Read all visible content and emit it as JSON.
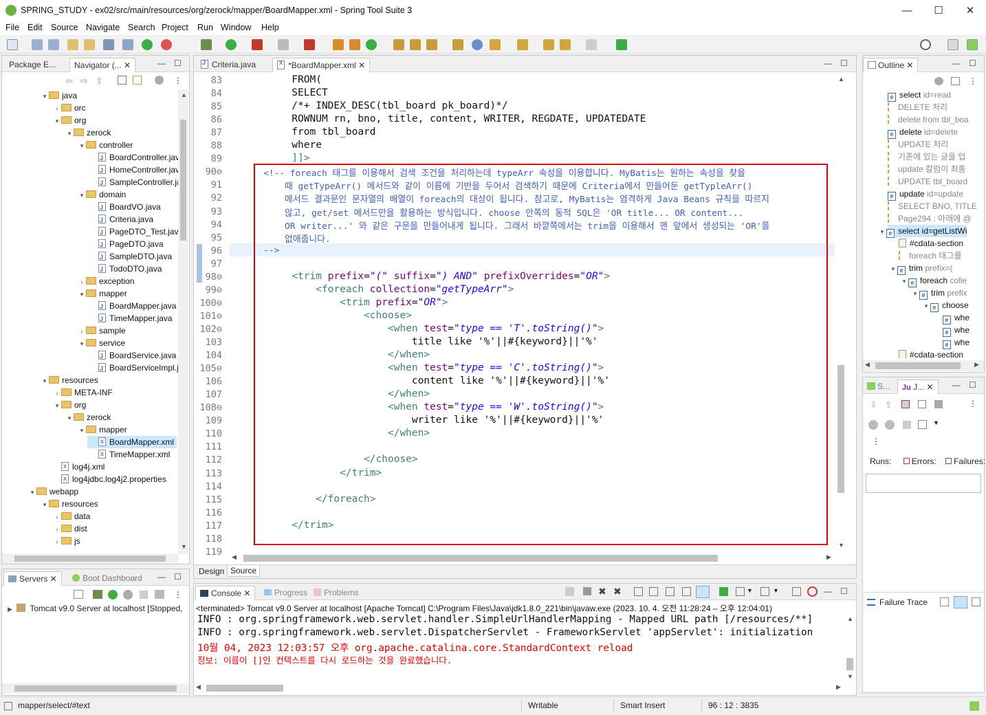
{
  "window": {
    "title": "SPRING_STUDY - ex02/src/main/resources/org/zerock/mapper/BoardMapper.xml - Spring Tool Suite 3",
    "min": "—",
    "max": "☐",
    "close": "✕"
  },
  "menu": [
    "File",
    "Edit",
    "Source",
    "Navigate",
    "Search",
    "Project",
    "Run",
    "Window",
    "Help"
  ],
  "left_panel": {
    "tabs": [
      "Package E...",
      "Navigator (...",
      "✕"
    ],
    "tree": [
      {
        "label": "java",
        "depth": 0,
        "type": "folder",
        "open": true
      },
      {
        "label": "orc",
        "depth": 1,
        "type": "folder",
        "open": false
      },
      {
        "label": "org",
        "depth": 1,
        "type": "folder",
        "open": true
      },
      {
        "label": "zerock",
        "depth": 2,
        "type": "folder",
        "open": true
      },
      {
        "label": "controller",
        "depth": 3,
        "type": "folder",
        "open": true
      },
      {
        "label": "BoardController.java",
        "depth": 4,
        "type": "java"
      },
      {
        "label": "HomeController.java",
        "depth": 4,
        "type": "java"
      },
      {
        "label": "SampleController.java",
        "depth": 4,
        "type": "java"
      },
      {
        "label": "domain",
        "depth": 3,
        "type": "folder",
        "open": true
      },
      {
        "label": "BoardVO.java",
        "depth": 4,
        "type": "java"
      },
      {
        "label": "Criteria.java",
        "depth": 4,
        "type": "java"
      },
      {
        "label": "PageDTO_Test.java",
        "depth": 4,
        "type": "java"
      },
      {
        "label": "PageDTO.java",
        "depth": 4,
        "type": "java"
      },
      {
        "label": "SampleDTO.java",
        "depth": 4,
        "type": "java"
      },
      {
        "label": "TodoDTO.java",
        "depth": 4,
        "type": "java"
      },
      {
        "label": "exception",
        "depth": 3,
        "type": "folder",
        "open": false
      },
      {
        "label": "mapper",
        "depth": 3,
        "type": "folder",
        "open": true
      },
      {
        "label": "BoardMapper.java",
        "depth": 4,
        "type": "java"
      },
      {
        "label": "TimeMapper.java",
        "depth": 4,
        "type": "java"
      },
      {
        "label": "sample",
        "depth": 3,
        "type": "folder",
        "open": false
      },
      {
        "label": "service",
        "depth": 3,
        "type": "folder",
        "open": true
      },
      {
        "label": "BoardService.java",
        "depth": 4,
        "type": "java"
      },
      {
        "label": "BoardServiceImpl.java",
        "depth": 4,
        "type": "java"
      },
      {
        "label": "resources",
        "depth": 0,
        "type": "folder",
        "open": true
      },
      {
        "label": "META-INF",
        "depth": 1,
        "type": "folder",
        "open": false
      },
      {
        "label": "org",
        "depth": 1,
        "type": "folder",
        "open": true
      },
      {
        "label": "zerock",
        "depth": 2,
        "type": "folder",
        "open": true
      },
      {
        "label": "mapper",
        "depth": 3,
        "type": "folder",
        "open": true
      },
      {
        "label": "BoardMapper.xml",
        "depth": 4,
        "type": "xml",
        "selected": true
      },
      {
        "label": "TimeMapper.xml",
        "depth": 4,
        "type": "xml"
      },
      {
        "label": "log4j.xml",
        "depth": 1,
        "type": "xml"
      },
      {
        "label": "log4jdbc.log4j2.properties",
        "depth": 1,
        "type": "xml"
      },
      {
        "label": "webapp",
        "depth": -1,
        "type": "folder",
        "open": true
      },
      {
        "label": "resources",
        "depth": 0,
        "type": "folder",
        "open": true
      },
      {
        "label": "data",
        "depth": 1,
        "type": "folder",
        "open": false
      },
      {
        "label": "dist",
        "depth": 1,
        "type": "folder",
        "open": false
      },
      {
        "label": "js",
        "depth": 1,
        "type": "folder",
        "open": false
      }
    ]
  },
  "servers_panel": {
    "tabs": [
      "Servers",
      "Boot Dashboard"
    ],
    "server_row": "Tomcat v9.0 Server at localhost  [Stopped,"
  },
  "editor": {
    "tabs": [
      {
        "label": "Criteria.java",
        "active": false
      },
      {
        "label": "*BoardMapper.xml",
        "active": true
      }
    ],
    "bottom_tabs": [
      "Design",
      "Source"
    ],
    "lines": [
      {
        "n": "83",
        "t": "          FROM("
      },
      {
        "n": "84",
        "t": "          SELECT"
      },
      {
        "n": "85",
        "t": "          /*+ INDEX_DESC(tbl_board pk_board)*/"
      },
      {
        "n": "86",
        "t": "          ROWNUM rn, bno, title, content, WRITER, REGDATE, UPDATEDATE"
      },
      {
        "n": "87",
        "t": "          from tbl_board"
      },
      {
        "n": "88",
        "t": "          where"
      },
      {
        "n": "89",
        "t": "          ]]>"
      },
      {
        "n": "90⊖",
        "t": "      <!-- foreach 태그를 이용해서 검색 조건을 처리하는데 typeArr 속성을 이용합니다. MyBatis는 원하는 속성을 찾을"
      },
      {
        "n": "91",
        "t": "          때 getTypeArr() 메서드와 같이 이름에 기반을 두어서 검색하기 때문에 Criteria에서 만들어둔 getTypleArr()"
      },
      {
        "n": "92",
        "t": "          메서드 결과문인 문자열의 배열이 foreach의 대상이 됩니다. 참고로, MyBatis는 엄격하게 Java Beans 규칙을 따르지"
      },
      {
        "n": "93",
        "t": "          않고, get/set 메서드만을 활용하는 방식입니다. choose 안쪽의 동적 SQL은 'OR title... OR content..."
      },
      {
        "n": "94",
        "t": "          OR writer...' 와 같은 구문을 만들어내게 됩니다. 그래서 바깥쪽에서는 trim을 이용해서 맨 앞에서 생성되는 'OR'를"
      },
      {
        "n": "95",
        "t": "          없애줍니다."
      },
      {
        "n": "96",
        "t": "      -->"
      },
      {
        "n": "97",
        "t": ""
      },
      {
        "n": "98⊖",
        "t": "          <trim prefix=\"(\" suffix=\") AND\" prefixOverrides=\"OR\">"
      },
      {
        "n": "99⊖",
        "t": "              <foreach collection=\"getTypeArr\">"
      },
      {
        "n": "100⊖",
        "t": "                  <trim prefix=\"OR\">"
      },
      {
        "n": "101⊖",
        "t": "                      <choose>"
      },
      {
        "n": "102⊖",
        "t": "                          <when test=\"type == 'T'.toString()\">"
      },
      {
        "n": "103",
        "t": "                              title like '%'||#{keyword}||'%'"
      },
      {
        "n": "104",
        "t": "                          </when>"
      },
      {
        "n": "105⊖",
        "t": "                          <when test=\"type == 'C'.toString()\">"
      },
      {
        "n": "106",
        "t": "                              content like '%'||#{keyword}||'%'"
      },
      {
        "n": "107",
        "t": "                          </when>"
      },
      {
        "n": "108⊖",
        "t": "                          <when test=\"type == 'W'.toString()\">"
      },
      {
        "n": "109",
        "t": "                              writer like '%'||#{keyword}||'%'"
      },
      {
        "n": "110",
        "t": "                          </when>"
      },
      {
        "n": "111",
        "t": ""
      },
      {
        "n": "112",
        "t": "                      </choose>"
      },
      {
        "n": "113",
        "t": "                  </trim>"
      },
      {
        "n": "114",
        "t": ""
      },
      {
        "n": "115",
        "t": "              </foreach>"
      },
      {
        "n": "116",
        "t": ""
      },
      {
        "n": "117",
        "t": "          </trim>"
      },
      {
        "n": "118",
        "t": ""
      },
      {
        "n": "119",
        "t": ""
      }
    ]
  },
  "outline": {
    "tab": "Outline",
    "items": [
      {
        "label": "select",
        "attr": " id=read",
        "icon": "e",
        "depth": 0
      },
      {
        "label": "DELETE 처리",
        "icon": "d",
        "depth": 0
      },
      {
        "label": "delete from tbl_boa",
        "icon": "d",
        "depth": 0
      },
      {
        "label": "delete",
        "attr": " id=delete",
        "icon": "e",
        "depth": 0
      },
      {
        "label": "UPDATE 처리",
        "icon": "d",
        "depth": 0
      },
      {
        "label": "기존에 있는 글을 업",
        "icon": "d",
        "depth": 0
      },
      {
        "label": "update 칼럼이 최종",
        "icon": "d",
        "depth": 0
      },
      {
        "label": "UPDATE tbl_board",
        "icon": "d",
        "depth": 0
      },
      {
        "label": "update",
        "attr": " id=update",
        "icon": "e",
        "depth": 0
      },
      {
        "label": "SELECT BNO, TITLE",
        "icon": "d",
        "depth": 0
      },
      {
        "label": "Page294 : 아래에 @",
        "icon": "d",
        "depth": 0
      },
      {
        "label": "select id=getListWi",
        "icon": "e",
        "depth": 0,
        "selected": true
      },
      {
        "label": "#cdata-section",
        "icon": "c",
        "depth": 1
      },
      {
        "label": "foreach 태그를",
        "icon": "d",
        "depth": 1
      },
      {
        "label": "trim",
        "attr": " prefix=(",
        "icon": "e",
        "depth": 1
      },
      {
        "label": "foreach",
        "attr": " colle",
        "icon": "e",
        "depth": 2
      },
      {
        "label": "trim",
        "attr": " prefix",
        "icon": "e",
        "depth": 3
      },
      {
        "label": "choose",
        "icon": "e",
        "depth": 4
      },
      {
        "label": "whe",
        "icon": "e",
        "depth": 5
      },
      {
        "label": "whe",
        "icon": "e",
        "depth": 5
      },
      {
        "label": "whe",
        "icon": "e",
        "depth": 5
      },
      {
        "label": "#cdata-section",
        "icon": "c",
        "depth": 1
      }
    ]
  },
  "junit": {
    "tabs": [
      "S...",
      "J..."
    ],
    "runs": "Runs:",
    "errors": "Errors:",
    "failures": "Failures:",
    "failure_trace": "Failure Trace"
  },
  "console": {
    "tabs": [
      "Console",
      "Progress",
      "Problems"
    ],
    "header": "<terminated> Tomcat v9.0 Server at localhost [Apache Tomcat] C:\\Program Files\\Java\\jdk1.8.0_221\\bin\\javaw.exe  (2023. 10. 4. 오전 11:28:24 – 오후 12:04:01)",
    "lines": [
      {
        "t": "INFO : org.springframework.web.servlet.handler.SimpleUrlHandlerMapping - Mapped URL path [/resources/**]",
        "red": false
      },
      {
        "t": "INFO : org.springframework.web.servlet.DispatcherServlet - FrameworkServlet 'appServlet': initialization",
        "red": false
      },
      {
        "t": "10월 04, 2023 12:03:57 오후 org.apache.catalina.core.StandardContext reload",
        "red": true
      },
      {
        "t": "정보: 이름이 []인 컨텍스트를 다시 로드하는 것을 완료했습니다.",
        "red": true,
        "small": true
      }
    ]
  },
  "status": {
    "path": "mapper/select/#text",
    "writable": "Writable",
    "insert": "Smart Insert",
    "position": "96 : 12 : 3835"
  },
  "colors": {
    "highlight_box": "#e00000",
    "comment": "#3f5fbf",
    "tag": "#3f7f7f",
    "attr": "#7f007f",
    "value": "#2a00ff",
    "error_text": "#e00000"
  }
}
